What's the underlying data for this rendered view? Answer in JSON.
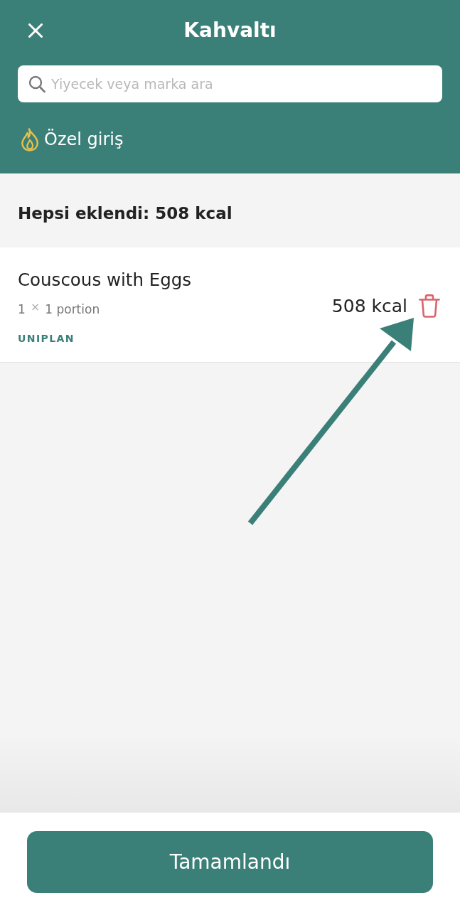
{
  "header": {
    "title": "Kahvaltı"
  },
  "search": {
    "placeholder": "Yiyecek veya marka ara"
  },
  "custom_entry": {
    "label": "Özel giriş"
  },
  "summary": {
    "text": "Hepsi eklendi: 508 kcal"
  },
  "entries": [
    {
      "name": "Couscous with Eggs",
      "quantity": "1 $^{×}$ 1 portion",
      "source": "UNIPLAN",
      "calories": "508 kcal"
    }
  ],
  "done_button": {
    "label": "Tamamlandı"
  }
}
